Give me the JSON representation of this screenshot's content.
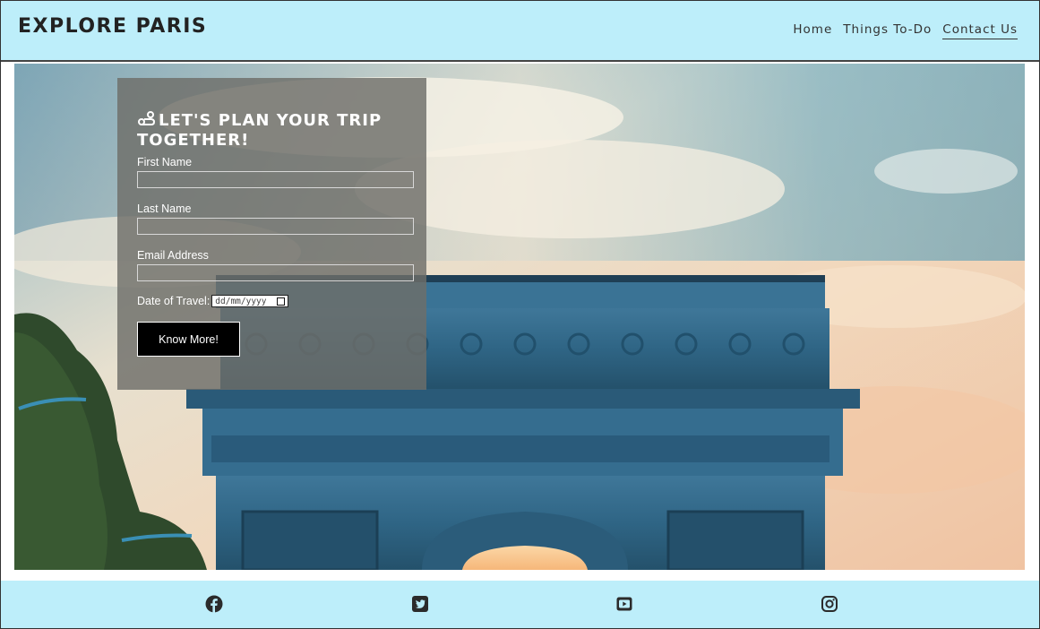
{
  "header": {
    "brand": "EXPLORE PARIS",
    "nav": [
      {
        "label": "Home"
      },
      {
        "label": "Things To-Do"
      },
      {
        "label": "Contact Us",
        "active": true
      }
    ]
  },
  "form": {
    "title": "LET'S PLAN YOUR TRIP TOGETHER!",
    "title_icon": "route-icon",
    "first_name_label": "First Name",
    "last_name_label": "Last Name",
    "email_label": "Email Address",
    "date_label": "Date of Travel:",
    "date_placeholder": "dd/mm/yyyy",
    "submit_label": "Know More!"
  },
  "footer": {
    "social": [
      "facebook-icon",
      "twitter-icon",
      "youtube-icon",
      "instagram-icon"
    ]
  },
  "colors": {
    "header_bg": "#bdeefa",
    "footer_bg": "#bdeefa",
    "button_bg": "#000000",
    "form_overlay": "#6e6e69"
  }
}
